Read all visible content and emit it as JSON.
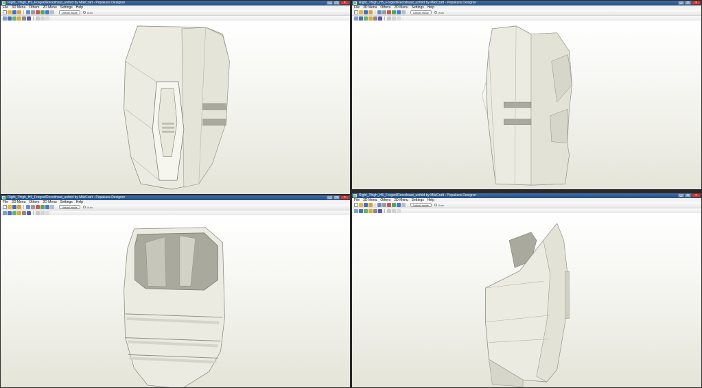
{
  "title": "Right_Thigh_H5_Forged/Recoilnaut_unfold by MikiCraft - Pepakura Designer",
  "menu": [
    "File",
    "3D Menu",
    "Others",
    "2D Menu",
    "Settings",
    "Help"
  ],
  "unfold_label": "Unfold mode",
  "auto_label": "Auto",
  "window_buttons": [
    "_",
    "□",
    "×"
  ],
  "colors": {
    "model": "#ecebe1",
    "model_edge": "#8e8e82",
    "interior": "#a9a99e",
    "titlebar": "#2f5d93"
  },
  "icons": [
    "new-icon",
    "open-icon",
    "save-icon",
    "view-icon",
    "select-icon",
    "rotate-icon",
    "move-icon",
    "edge-icon",
    "paint-icon",
    "zoom-icon"
  ],
  "windows": [
    {
      "view": "front"
    },
    {
      "view": "side"
    },
    {
      "view": "top"
    },
    {
      "view": "back"
    }
  ]
}
